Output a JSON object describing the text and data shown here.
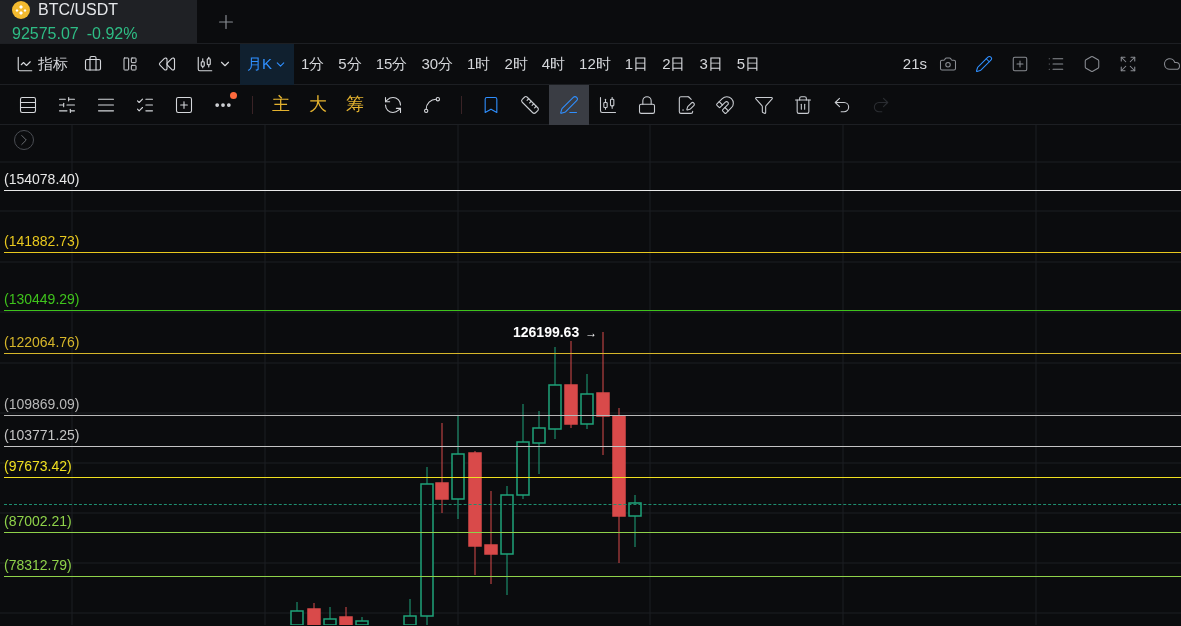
{
  "tab": {
    "symbol": "BTC/USDT",
    "price": "92575.07",
    "change": "-0.92%"
  },
  "toolbar": {
    "indicator": "指标",
    "intervals": [
      {
        "label": "月K",
        "selected": true,
        "dropdown": true
      },
      {
        "label": "1分",
        "selected": false,
        "dropdown": false
      },
      {
        "label": "5分",
        "selected": false,
        "dropdown": false
      },
      {
        "label": "15分",
        "selected": false,
        "dropdown": false
      },
      {
        "label": "30分",
        "selected": false,
        "dropdown": false
      },
      {
        "label": "1时",
        "selected": false,
        "dropdown": false
      },
      {
        "label": "2时",
        "selected": false,
        "dropdown": false
      },
      {
        "label": "4时",
        "selected": false,
        "dropdown": false
      },
      {
        "label": "12时",
        "selected": false,
        "dropdown": false
      },
      {
        "label": "1日",
        "selected": false,
        "dropdown": false
      },
      {
        "label": "2日",
        "selected": false,
        "dropdown": false
      },
      {
        "label": "3日",
        "selected": false,
        "dropdown": false
      },
      {
        "label": "5日",
        "selected": false,
        "dropdown": false
      }
    ],
    "refresh": "21s",
    "right_tools": [
      {
        "kind": "camera",
        "on": false
      },
      {
        "kind": "pencil",
        "on": true
      },
      {
        "kind": "add-window",
        "on": false
      },
      {
        "kind": "list",
        "on": false
      },
      {
        "kind": "settings",
        "on": false
      },
      {
        "kind": "fullscreen",
        "on": false
      },
      {
        "kind": "cloud",
        "on": false
      }
    ]
  },
  "toolbar2": {
    "more_badge": true,
    "overlays": [
      "主",
      "大",
      "筹"
    ],
    "drawing_tools": [
      {
        "kind": "bookmark",
        "on": true,
        "selected": false,
        "disabled": false
      },
      {
        "kind": "ruler",
        "on": false,
        "selected": false,
        "disabled": false
      },
      {
        "kind": "pen",
        "on": true,
        "selected": true,
        "disabled": false
      },
      {
        "kind": "candles",
        "on": false,
        "selected": false,
        "disabled": false
      },
      {
        "kind": "lock",
        "on": false,
        "selected": false,
        "disabled": false
      },
      {
        "kind": "note",
        "on": false,
        "selected": false,
        "disabled": false
      },
      {
        "kind": "magnet",
        "on": false,
        "selected": false,
        "disabled": false
      },
      {
        "kind": "filter",
        "on": false,
        "selected": false,
        "disabled": false
      },
      {
        "kind": "trash",
        "on": false,
        "selected": false,
        "disabled": false
      },
      {
        "kind": "undo",
        "on": false,
        "selected": false,
        "disabled": false
      },
      {
        "kind": "redo",
        "on": false,
        "selected": false,
        "disabled": true
      }
    ]
  },
  "chart": {
    "high_label": "126199.63",
    "arrow": "→",
    "levels": [
      {
        "label": "(154078.40)",
        "color": "#e8e8e8"
      },
      {
        "label": "(141882.73)",
        "color": "#e8c81e"
      },
      {
        "label": "(130449.29)",
        "color": "#3fc31c"
      },
      {
        "label": "(122064.76)",
        "color": "#d6b62a"
      },
      {
        "label": "(109869.09)",
        "color": "#b8b8b8"
      },
      {
        "label": "(103771.25)",
        "color": "#c4c4c4"
      },
      {
        "label": "(97673.42)",
        "color": "#f0e020"
      },
      {
        "label": "(87002.21)",
        "color": "#8fd24a"
      },
      {
        "label": "(78312.79)",
        "color": "#8fd24a"
      }
    ]
  }
}
